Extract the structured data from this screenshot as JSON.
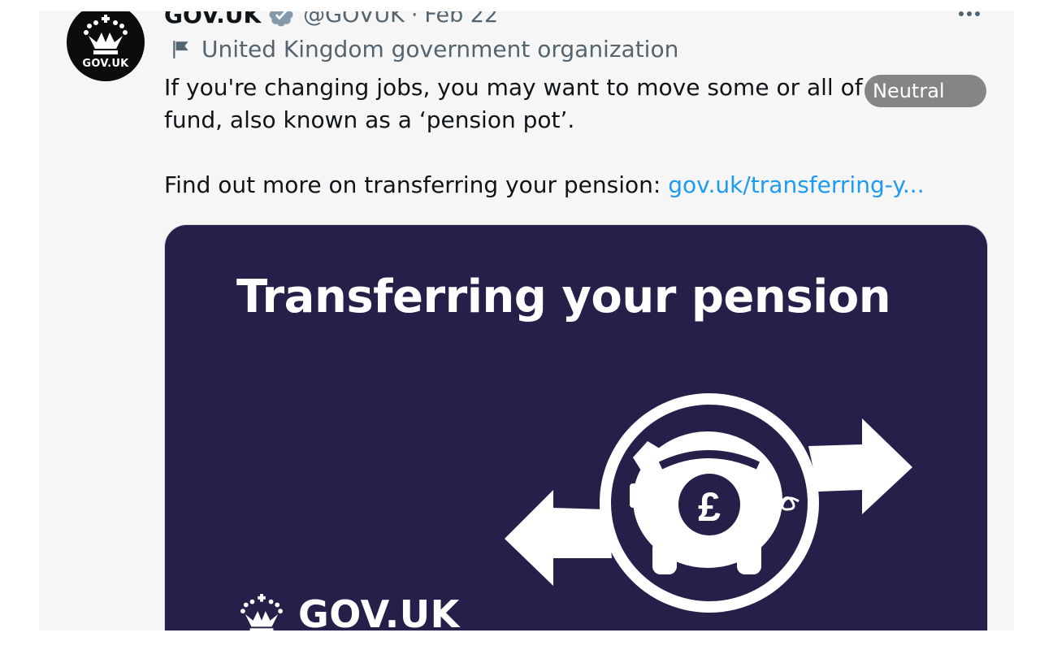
{
  "tweet": {
    "author_name": "GOV.UK",
    "handle": "@GOVUK",
    "separator": "·",
    "date": "Feb 22",
    "affiliation": "United Kingdom government organization",
    "avatar_label": "GOV.UK",
    "text_line1": "If you're changing jobs, you may want to move some or all of you",
    "text_line2": "fund, also known as a ‘pension pot’.",
    "text_line3": "Find out more on transferring your pension: ",
    "link_text": "gov.uk/transferring-y...",
    "sentiment_badge": "Neutral"
  },
  "media": {
    "title": "Transferring your pension",
    "logo_text": "GOV.UK",
    "currency_symbol": "£",
    "background_color": "#25204a"
  },
  "colors": {
    "text": "#0f1419",
    "secondary_text": "#536471",
    "link": "#1d9bf0",
    "card_bg": "#f6f6f6",
    "badge_bg": "#858585"
  },
  "icons": [
    "crown-icon",
    "verified-badge-icon",
    "flag-icon",
    "more-options-icon",
    "piggy-bank-icon",
    "arrow-left-icon",
    "arrow-right-icon"
  ]
}
